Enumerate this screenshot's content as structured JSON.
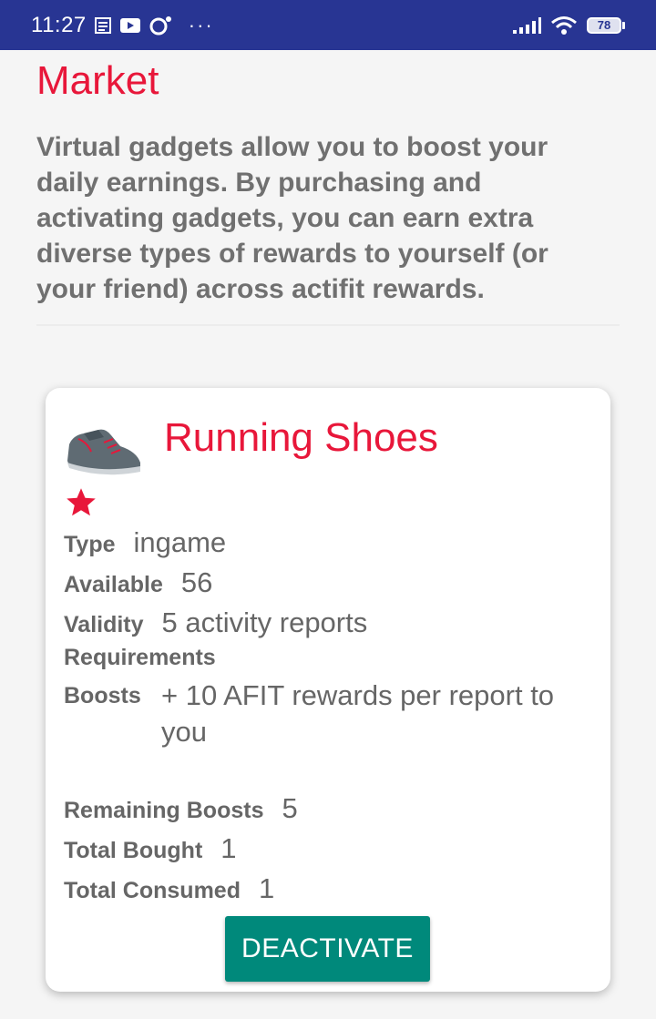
{
  "status_bar": {
    "time": "11:27",
    "battery": "78",
    "icons": [
      "notes-icon",
      "video-icon",
      "circle-dot-icon",
      "more-dots-icon",
      "signal-icon",
      "wifi-icon",
      "battery-icon"
    ],
    "more": "···"
  },
  "page": {
    "title": "Market",
    "intro": "Virtual gadgets allow you to boost your daily earnings. By purchasing and activating gadgets, you can earn extra diverse types of rewards to yourself (or your friend) across actifit rewards."
  },
  "gadget": {
    "name": "Running Shoes",
    "icon": "shoe-icon",
    "rating_icon": "star-icon",
    "accent_color": "#e8173a",
    "type_label": "Type",
    "type_value": "ingame",
    "available_label": "Available",
    "available_value": "56",
    "validity_label": "Validity",
    "validity_value": "5 activity reports",
    "requirements_label": "Requirements",
    "boosts_label": "Boosts",
    "boosts_value": "+ 10 AFIT rewards per report to you",
    "remaining_label": "Remaining Boosts",
    "remaining_value": "5",
    "bought_label": "Total Bought",
    "bought_value": "1",
    "consumed_label": "Total Consumed",
    "consumed_value": "1",
    "button_label": "DEACTIVATE",
    "button_color": "#00897b"
  }
}
